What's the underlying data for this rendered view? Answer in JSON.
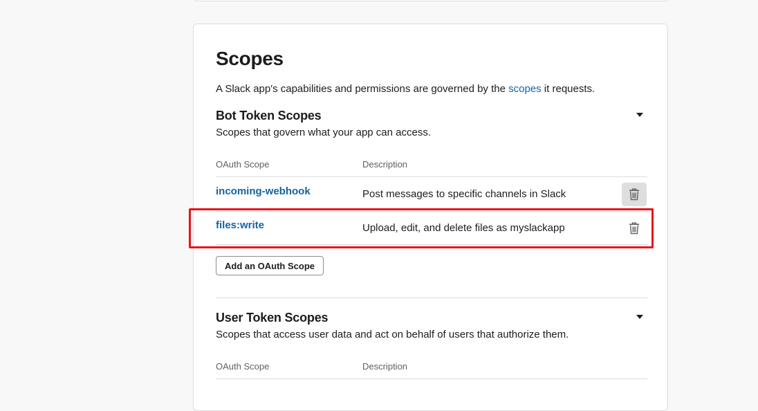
{
  "scopes_section": {
    "title": "Scopes",
    "intro_before": "A Slack app's capabilities and permissions are governed by the ",
    "intro_link": "scopes",
    "intro_after": " it requests."
  },
  "bot_token_scopes": {
    "title": "Bot Token Scopes",
    "description": "Scopes that govern what your app can access.",
    "col_scope": "OAuth Scope",
    "col_description": "Description",
    "rows": [
      {
        "scope": "incoming-webhook",
        "description": "Post messages to specific channels in Slack"
      },
      {
        "scope": "files:write",
        "description": "Upload, edit, and delete files as myslackapp"
      }
    ],
    "add_button": "Add an OAuth Scope"
  },
  "user_token_scopes": {
    "title": "User Token Scopes",
    "description": "Scopes that access user data and act on behalf of users that authorize them.",
    "col_scope": "OAuth Scope",
    "col_description": "Description"
  },
  "colors": {
    "link": "#1264a3",
    "highlight": "#e8121c",
    "hover_bg": "#dedede"
  },
  "icons": {
    "caret": "caret-down-icon",
    "delete": "trash-icon"
  }
}
